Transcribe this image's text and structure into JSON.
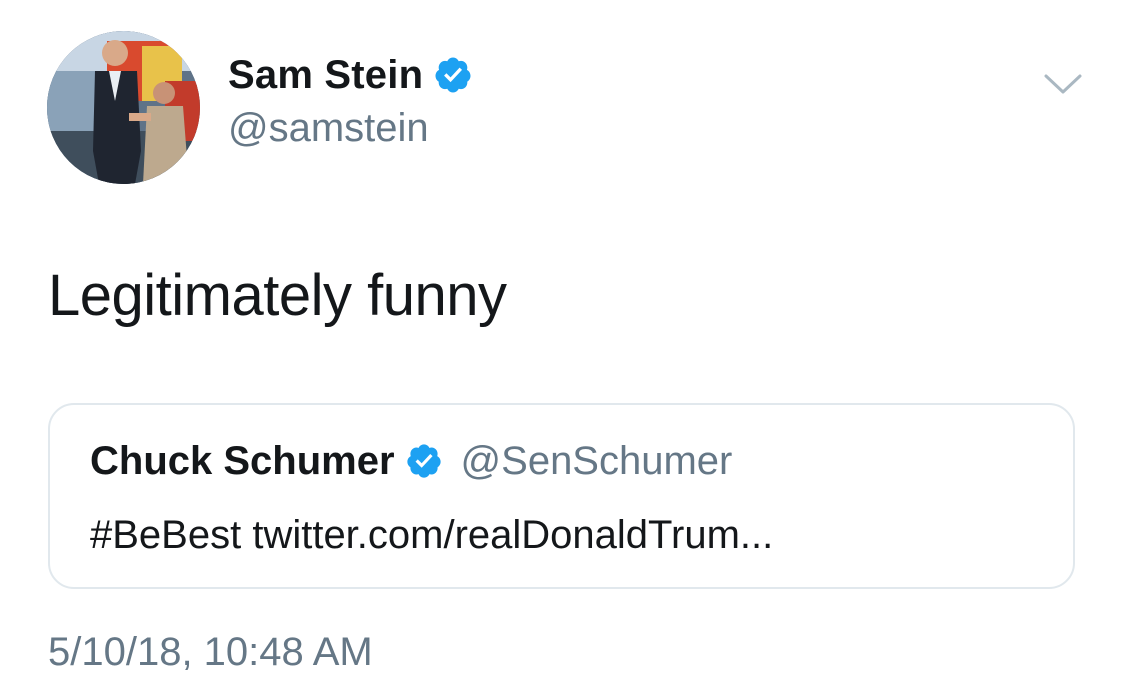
{
  "tweet": {
    "author": {
      "name": "Sam Stein",
      "handle": "@samstein",
      "verified": true,
      "avatar_icon": "profile-photo"
    },
    "text": "Legitimately funny",
    "menu_icon": "chevron-down-icon",
    "quoted_tweet": {
      "name": "Chuck Schumer",
      "handle": "@SenSchumer",
      "verified": true,
      "text": "#BeBest twitter.com/realDonaldTrum..."
    },
    "timestamp": "5/10/18, 10:48 AM"
  },
  "colors": {
    "primary_text": "#14171a",
    "secondary_text": "#657786",
    "verified_blue": "#1da1f2",
    "card_border": "#e1e8ed"
  }
}
